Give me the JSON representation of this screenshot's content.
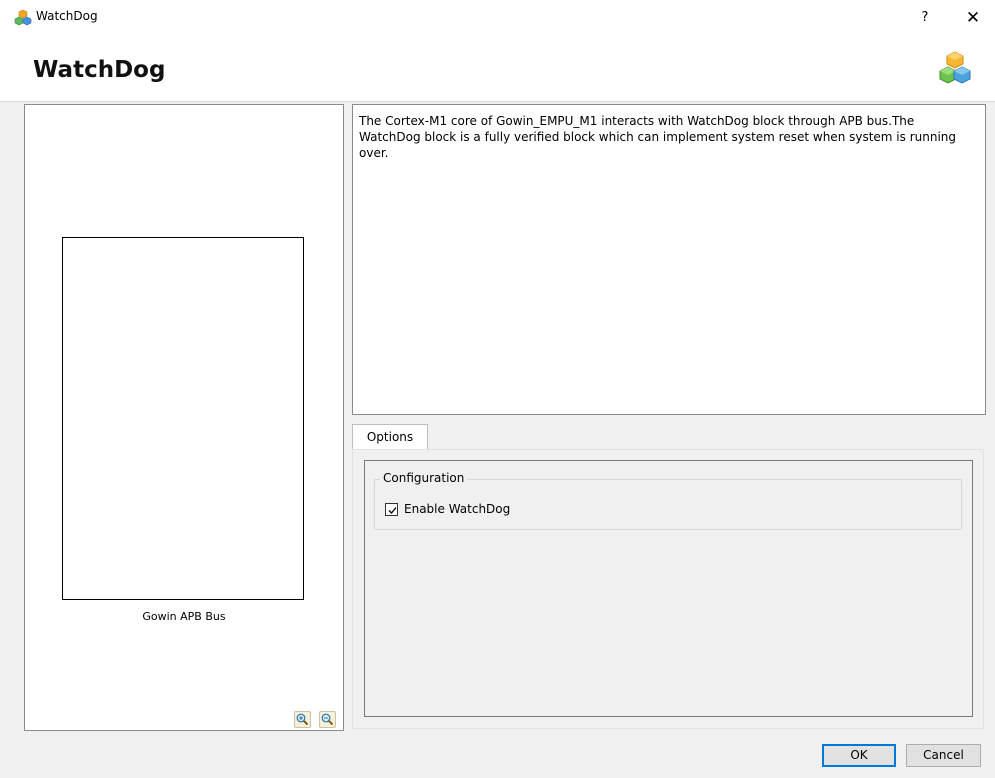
{
  "window": {
    "title": "WatchDog",
    "help_label": "?",
    "close_label": "✕"
  },
  "header": {
    "title": "WatchDog"
  },
  "diagram": {
    "bus_label": "Gowin APB Bus",
    "zoom_in_icon": "zoom-in-icon",
    "zoom_out_icon": "zoom-out-icon"
  },
  "description": {
    "text": "The Cortex-M1 core of Gowin_EMPU_M1 interacts with WatchDog block through APB bus.The WatchDog block is a fully verified block which can implement system reset when system is running over."
  },
  "tabs": [
    {
      "label": "Options",
      "selected": true
    }
  ],
  "options": {
    "group_title": "Configuration",
    "enable_label": "Enable WatchDog",
    "enable_checked": true
  },
  "buttons": {
    "ok_label": "OK",
    "cancel_label": "Cancel"
  },
  "colors": {
    "accent": "#0078d7",
    "background": "#f0f0f0"
  }
}
